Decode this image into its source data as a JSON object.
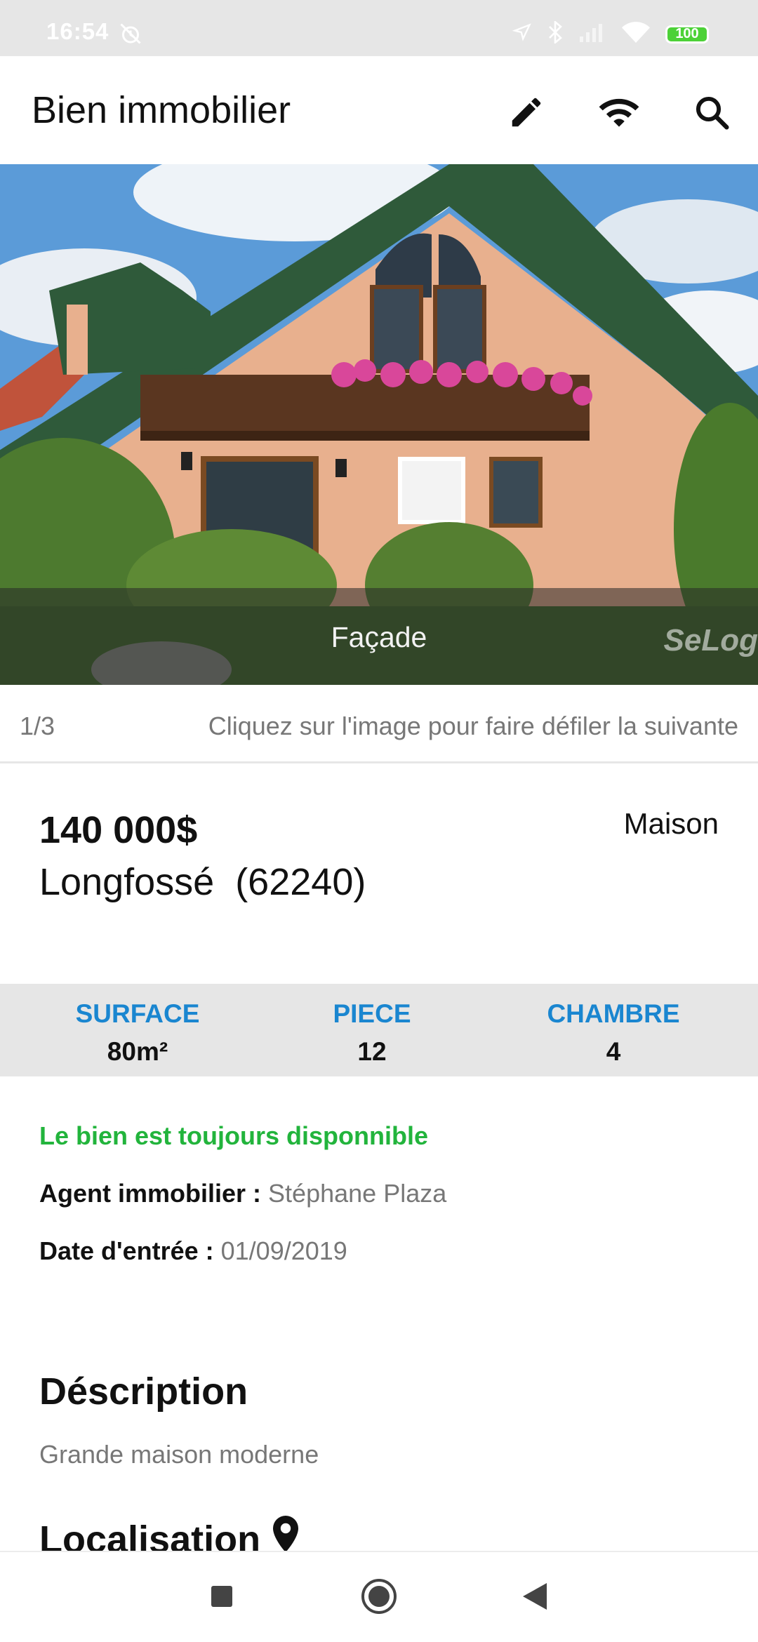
{
  "status_bar": {
    "time": "16:54",
    "battery": "100",
    "icons": [
      "alarm-off-icon",
      "location-arrow-icon",
      "bluetooth-icon",
      "signal-icon",
      "wifi-icon",
      "battery-icon"
    ]
  },
  "app_bar": {
    "title": "Bien immobilier",
    "actions": [
      "edit-icon",
      "wifi-icon",
      "search-icon"
    ]
  },
  "gallery": {
    "caption": "Façade",
    "watermark": "SeLog",
    "counter": "1/3",
    "hint": "Cliquez sur l'image pour faire défiler la suivante"
  },
  "listing": {
    "price": "140 000$",
    "city": "Longfossé  (62240)",
    "type": "Maison"
  },
  "stats": [
    {
      "label": "SURFACE",
      "value": "80m²"
    },
    {
      "label": "PIECE",
      "value": "12"
    },
    {
      "label": "CHAMBRE",
      "value": "4"
    }
  ],
  "details": {
    "availability": "Le bien est toujours disponnible",
    "agent_label": "Agent immobilier :",
    "agent_value": "Stéphane Plaza",
    "date_label": "Date d'entrée :",
    "date_value": "01/09/2019"
  },
  "description": {
    "title": "Déscription",
    "text": "Grande maison moderne"
  },
  "location": {
    "title": "Localisation"
  },
  "nav_bar": [
    "recents-square-icon",
    "home-circle-icon",
    "back-triangle-icon"
  ],
  "colors": {
    "accent_blue": "#1a86d0",
    "available_green": "#22b43c",
    "band_gray": "#e6e6e6"
  }
}
